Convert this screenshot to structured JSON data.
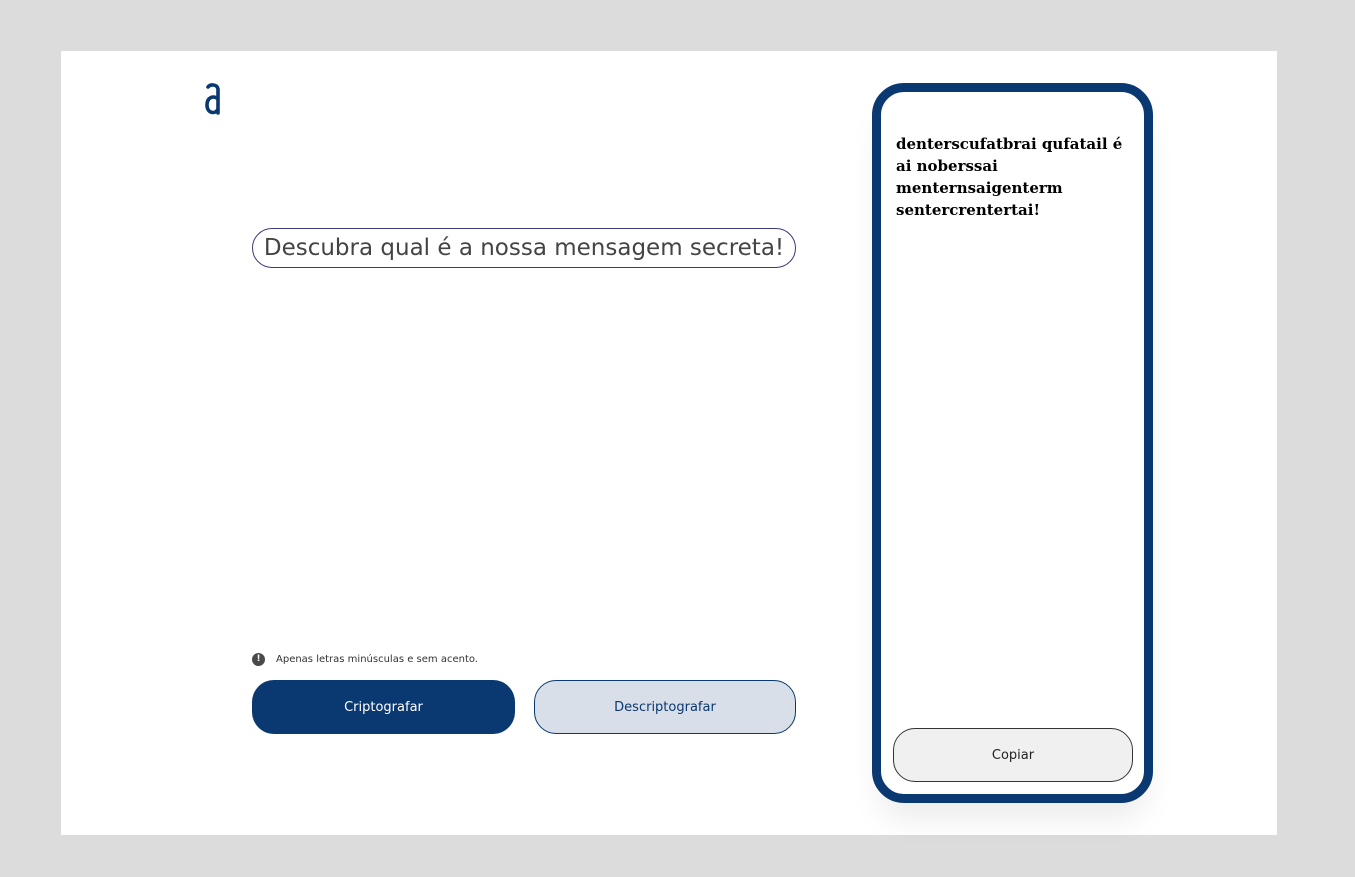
{
  "logo": {
    "icon": "alura-logo-icon",
    "color": "#0a3871"
  },
  "input": {
    "placeholder": "Descubra qual é a nossa mensagem secreta!"
  },
  "hint": {
    "icon": "info-icon",
    "icon_glyph": "!",
    "text": "Apenas letras minúsculas e sem acento."
  },
  "buttons": {
    "encrypt_label": "Criptografar",
    "decrypt_label": "Descriptografar"
  },
  "output": {
    "text": "denterscufatbrai qufatail é ai noberssai menternsaigenterm sentercrentertai!",
    "copy_label": "Copiar"
  },
  "colors": {
    "primary": "#0a3871",
    "secondary_bg": "#d8dfe8",
    "page_bg": "#dcdcdc"
  }
}
